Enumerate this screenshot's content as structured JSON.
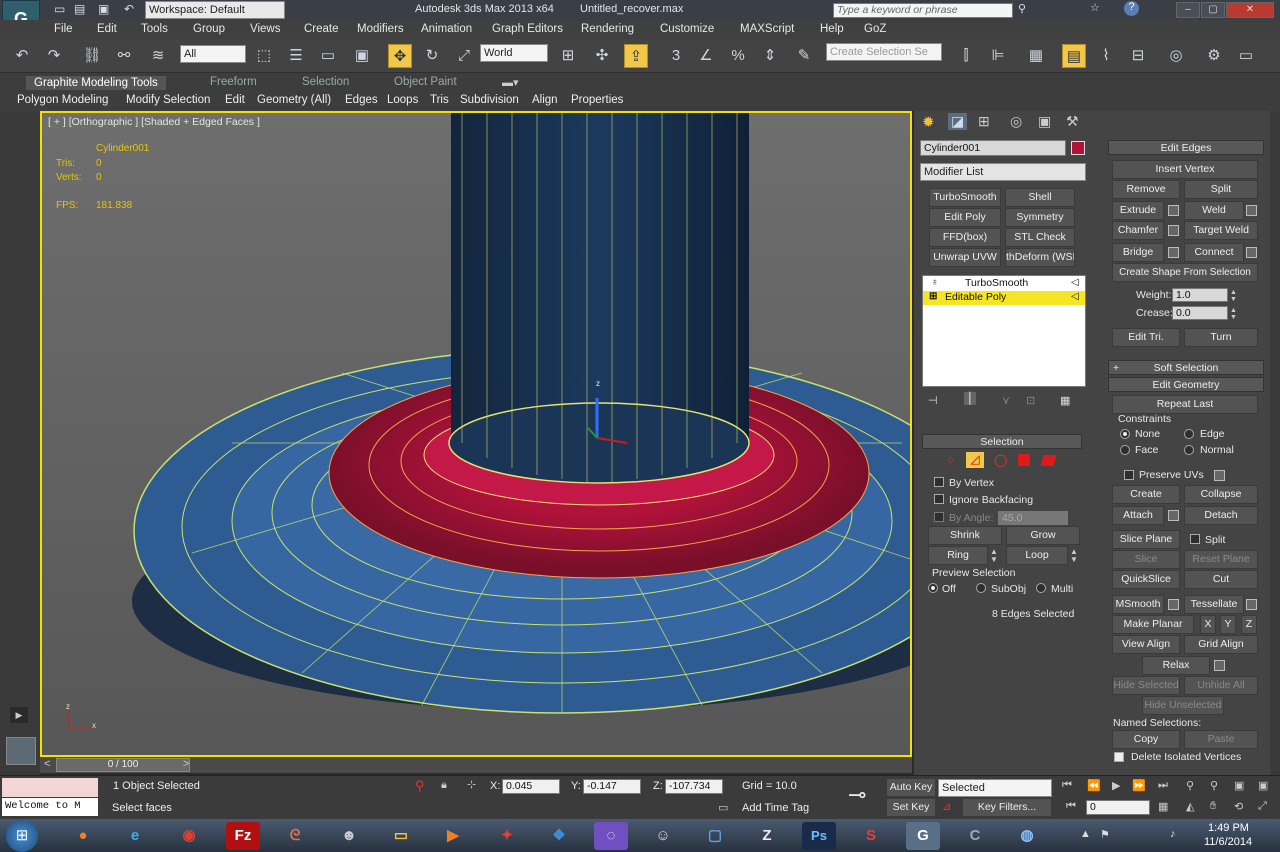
{
  "title_bar": {
    "workspace": "Workspace: Default",
    "app_title": "Autodesk 3ds Max  2013 x64",
    "file_name": "Untitled_recover.max",
    "search_placeholder": "Type a keyword or phrase"
  },
  "menu": [
    "File",
    "Edit",
    "Tools",
    "Group",
    "Views",
    "Create",
    "Modifiers",
    "Animation",
    "Graph Editors",
    "Rendering",
    "Customize",
    "MAXScript",
    "Help",
    "GoZ"
  ],
  "toolbar": {
    "selection_filter": "All",
    "reference_coord": "World",
    "named_selection_placeholder": "Create Selection Se"
  },
  "ribbon": {
    "tabs": [
      "Graphite Modeling Tools",
      "Freeform",
      "Selection",
      "Object Paint"
    ],
    "subtabs": [
      "Polygon Modeling",
      "Modify Selection",
      "Edit",
      "Geometry (All)",
      "Edges",
      "Loops",
      "Tris",
      "Subdivision",
      "Align",
      "Properties"
    ]
  },
  "viewport": {
    "label": "[ + ] [Orthographic ] [Shaded + Edged Faces ]",
    "object_name": "Cylinder001",
    "tris_label": "Tris:",
    "tris_value": "0",
    "verts_label": "Verts:",
    "verts_value": "0",
    "fps_label": "FPS:",
    "fps_value": "181.838",
    "gizmo_z": "z",
    "axis_z": "z",
    "axis_x": "x"
  },
  "timeline": {
    "frame": "0 / 100"
  },
  "modify_panel": {
    "object_name": "Cylinder001",
    "object_color": "#b0123a",
    "modifier_list": "Modifier List",
    "modifier_buttons": [
      "TurboSmooth",
      "Shell",
      "Edit Poly",
      "Symmetry",
      "FFD(box)",
      "STL Check",
      "Unwrap UVW",
      "thDeform (WSI"
    ],
    "stack": [
      {
        "name": "TurboSmooth",
        "selected": false
      },
      {
        "name": "Editable Poly",
        "selected": true
      }
    ],
    "selection": {
      "header": "Selection",
      "by_vertex": "By Vertex",
      "ignore_backfacing": "Ignore Backfacing",
      "by_angle": "By Angle:",
      "by_angle_value": "45.0",
      "shrink": "Shrink",
      "grow": "Grow",
      "ring": "Ring",
      "loop": "Loop",
      "preview_selection": "Preview Selection",
      "preview_off": "Off",
      "preview_subobj": "SubObj",
      "preview_multi": "Multi",
      "status": "8 Edges Selected"
    }
  },
  "edit_edges": {
    "header": "Edit Edges",
    "insert_vertex": "Insert Vertex",
    "remove": "Remove",
    "split": "Split",
    "extrude": "Extrude",
    "weld": "Weld",
    "chamfer": "Chamfer",
    "target_weld": "Target Weld",
    "bridge": "Bridge",
    "connect": "Connect",
    "create_shape": "Create Shape From Selection",
    "weight_label": "Weight:",
    "weight_value": "1.0",
    "crease_label": "Crease:",
    "crease_value": "0.0",
    "edit_tri": "Edit Tri.",
    "turn": "Turn"
  },
  "soft_selection": {
    "header": "Soft Selection"
  },
  "edit_geometry": {
    "header": "Edit Geometry",
    "repeat_last": "Repeat Last",
    "constraints": "Constraints",
    "none": "None",
    "edge": "Edge",
    "face": "Face",
    "normal": "Normal",
    "preserve_uvs": "Preserve UVs",
    "create": "Create",
    "collapse": "Collapse",
    "attach": "Attach",
    "detach": "Detach",
    "slice_plane": "Slice Plane",
    "split": "Split",
    "slice": "Slice",
    "reset_plane": "Reset Plane",
    "quickslice": "QuickSlice",
    "cut": "Cut",
    "msmooth": "MSmooth",
    "tessellate": "Tessellate",
    "make_planar": "Make Planar",
    "x": "X",
    "y": "Y",
    "z": "Z",
    "view_align": "View Align",
    "grid_align": "Grid Align",
    "relax": "Relax",
    "hide_selected": "Hide Selected",
    "unhide_all": "Unhide All",
    "hide_unselected": "Hide Unselected",
    "named_selections": "Named Selections:",
    "copy": "Copy",
    "paste": "Paste",
    "delete_isolated": "Delete Isolated Vertices"
  },
  "status_bar": {
    "maxscript_listener": "Welcome to M",
    "selection_count": "1 Object Selected",
    "prompt": "Select faces",
    "x_label": "X:",
    "x_value": "0.045",
    "y_label": "Y:",
    "y_value": "-0.147",
    "z_label": "Z:",
    "z_value": "-107.734",
    "grid": "Grid = 10.0",
    "add_time_tag": "Add Time Tag",
    "auto_key": "Auto Key",
    "set_key": "Set Key",
    "key_mode": "Selected",
    "key_filters": "Key Filters...",
    "frame_value": "0"
  },
  "taskbar": {
    "time": "1:49 PM",
    "date": "11/6/2014"
  }
}
